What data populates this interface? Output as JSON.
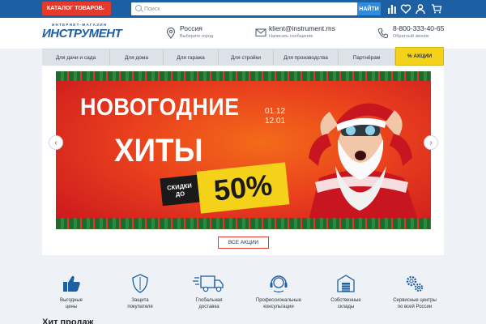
{
  "topbar": {
    "catalog_label": "КАТАЛОГ ТОВАРОВ",
    "search_placeholder": "Поиск",
    "find_label": "НАЙТИ",
    "icons": [
      "chart-icon",
      "heart-icon",
      "user-icon",
      "cart-icon"
    ]
  },
  "header": {
    "logo_top": "ИНТЕРНЕТ-МАГАЗИН",
    "logo_main": "ИНСТРУМЕНТ",
    "region": "Россия",
    "region_sub": "Выберите город",
    "email": "klient@instrument.ms",
    "email_sub": "Написать сообщение",
    "phone": "8-800-333-40-65",
    "phone_sub": "Обратный звонок"
  },
  "nav": {
    "items": [
      "Для дачи и сада",
      "Для дома",
      "Для гаража",
      "Для стройки",
      "Для производства",
      "Партнёрам",
      "% АКЦИИ"
    ]
  },
  "banner": {
    "title_line1": "НОВОГОДНИЕ",
    "title_line2": "ХИТЫ",
    "date_start": "01.12",
    "date_end": "12.01",
    "discount_label_1": "СКИДКИ",
    "discount_label_2": "ДО",
    "discount_value": "50%",
    "all_promo_label": "ВСЕ АКЦИИ",
    "colors": {
      "primary": "#1d5fa3",
      "accent": "#e53a2b",
      "highlight": "#f5d21a"
    }
  },
  "features": [
    {
      "icon": "thumbs-up-icon",
      "line1": "Выгодные",
      "line2": "цены"
    },
    {
      "icon": "shield-icon",
      "line1": "Защита",
      "line2": "покупателя"
    },
    {
      "icon": "truck-icon",
      "line1": "Глобальная",
      "line2": "доставка"
    },
    {
      "icon": "headset-icon",
      "line1": "Профессиональные",
      "line2": "консультации"
    },
    {
      "icon": "warehouse-icon",
      "line1": "Собственные",
      "line2": "склады"
    },
    {
      "icon": "gears-icon",
      "line1": "Сервисные центры",
      "line2": "по всей России"
    }
  ],
  "hits_title": "Хит продаж"
}
